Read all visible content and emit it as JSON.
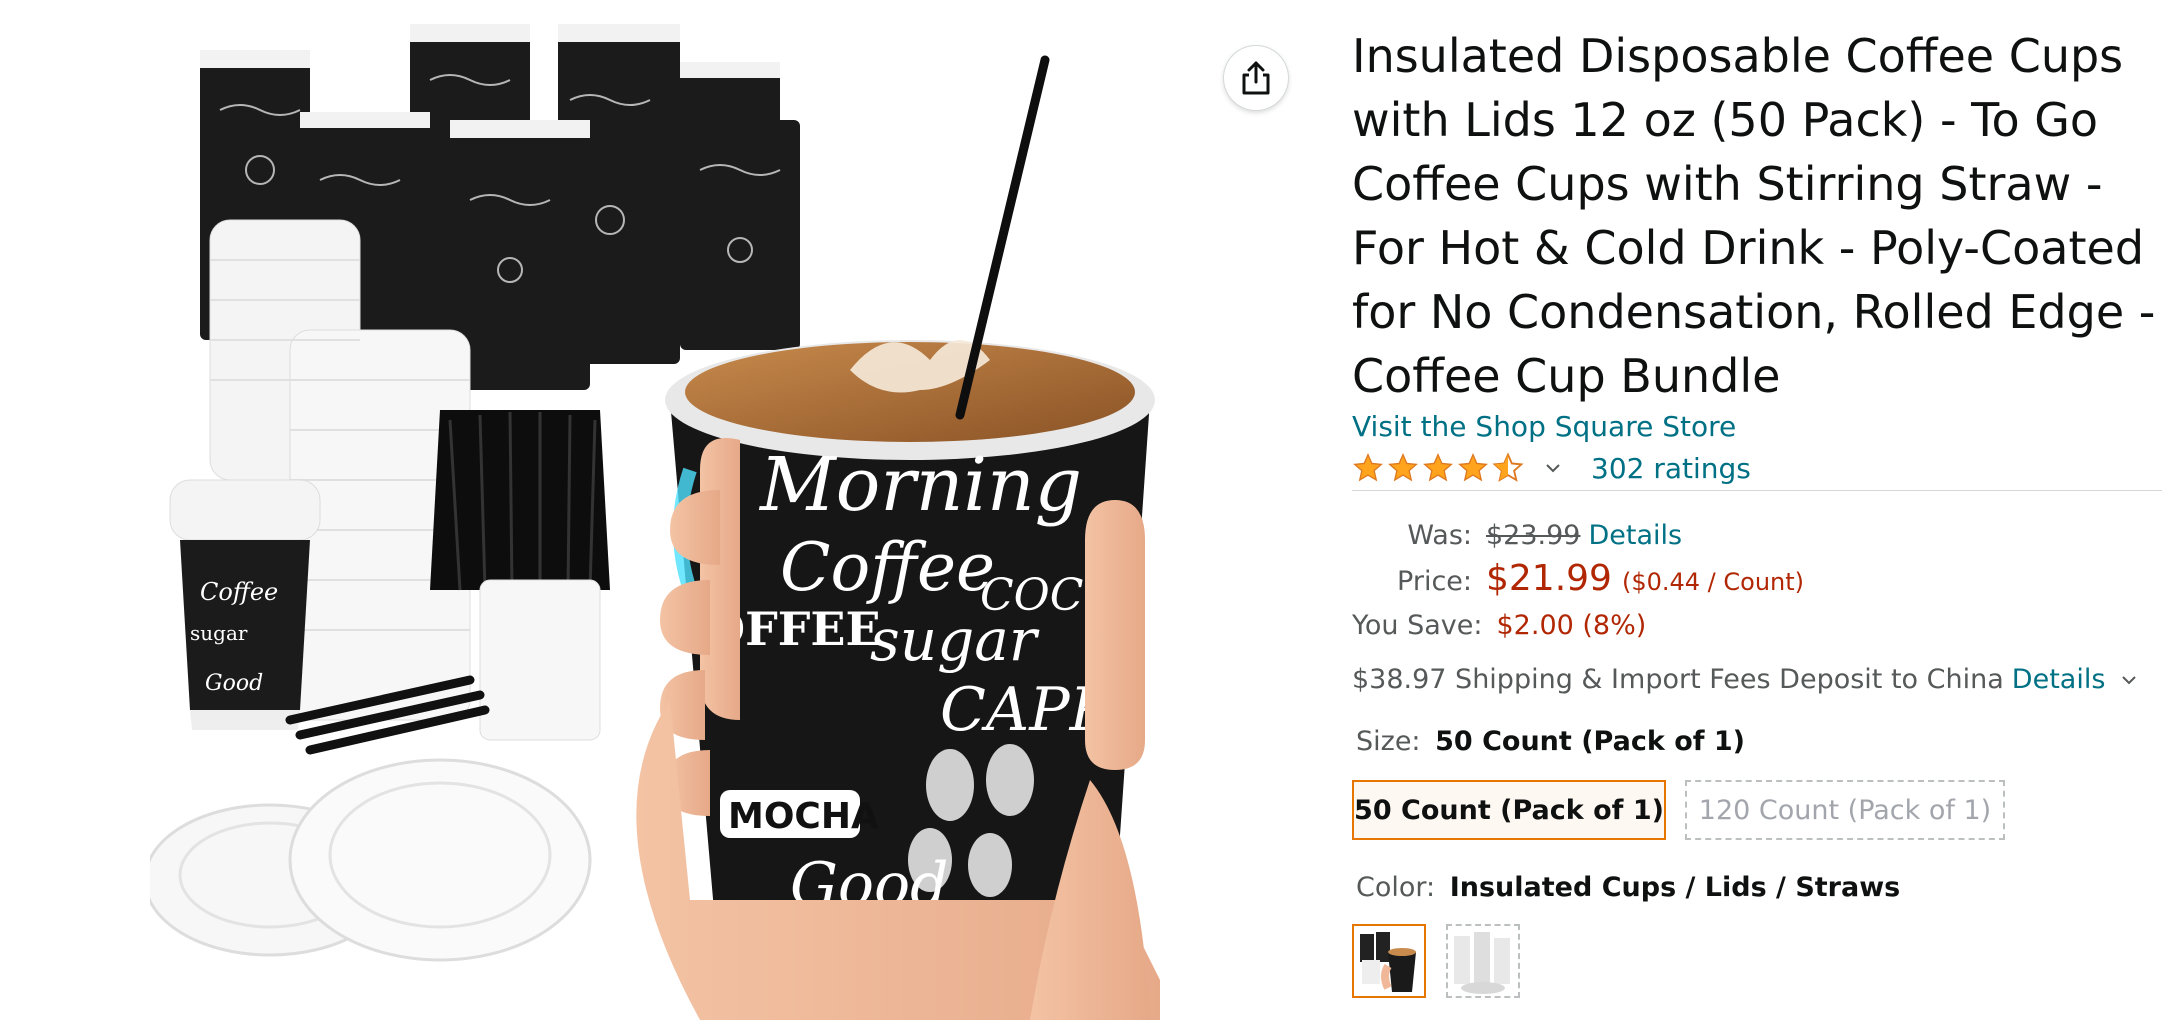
{
  "product": {
    "title": "Insulated Disposable Coffee Cups with Lids 12 oz (50 Pack) - To Go Coffee Cups with Stirring Straw - For Hot & Cold Drink - Poly-Coated for No Condensation, Rolled Edge - Coffee Cup Bundle",
    "store_link": "Visit the Shop Square Store",
    "rating": {
      "stars": 4.5,
      "count_text": "302 ratings"
    }
  },
  "image_text": {
    "cup_words": [
      "Morning",
      "Coffee",
      "sugar",
      "CAPP",
      "MOCHA",
      "Good",
      "Morning",
      "COFFEE",
      "HOT COCO"
    ]
  },
  "pricing": {
    "was_label": "Was:",
    "was_value": "$23.99",
    "was_details": "Details",
    "price_label": "Price:",
    "price_value": "$21.99",
    "price_unit": "($0.44 / Count)",
    "save_label": "You Save:",
    "save_value": "$2.00 (8%)"
  },
  "shipping": {
    "text": "$38.97 Shipping & Import Fees Deposit to China",
    "details": "Details"
  },
  "size": {
    "label": "Size:",
    "selected": "50 Count (Pack of 1)",
    "options": [
      "50 Count (Pack of 1)",
      "120 Count (Pack of 1)"
    ]
  },
  "color": {
    "label": "Color:",
    "selected": "Insulated Cups / Lids / Straws"
  },
  "colors": {
    "link": "#007185",
    "price": "#b12704",
    "star": "#ffa41c",
    "selected_border": "#e77600"
  }
}
